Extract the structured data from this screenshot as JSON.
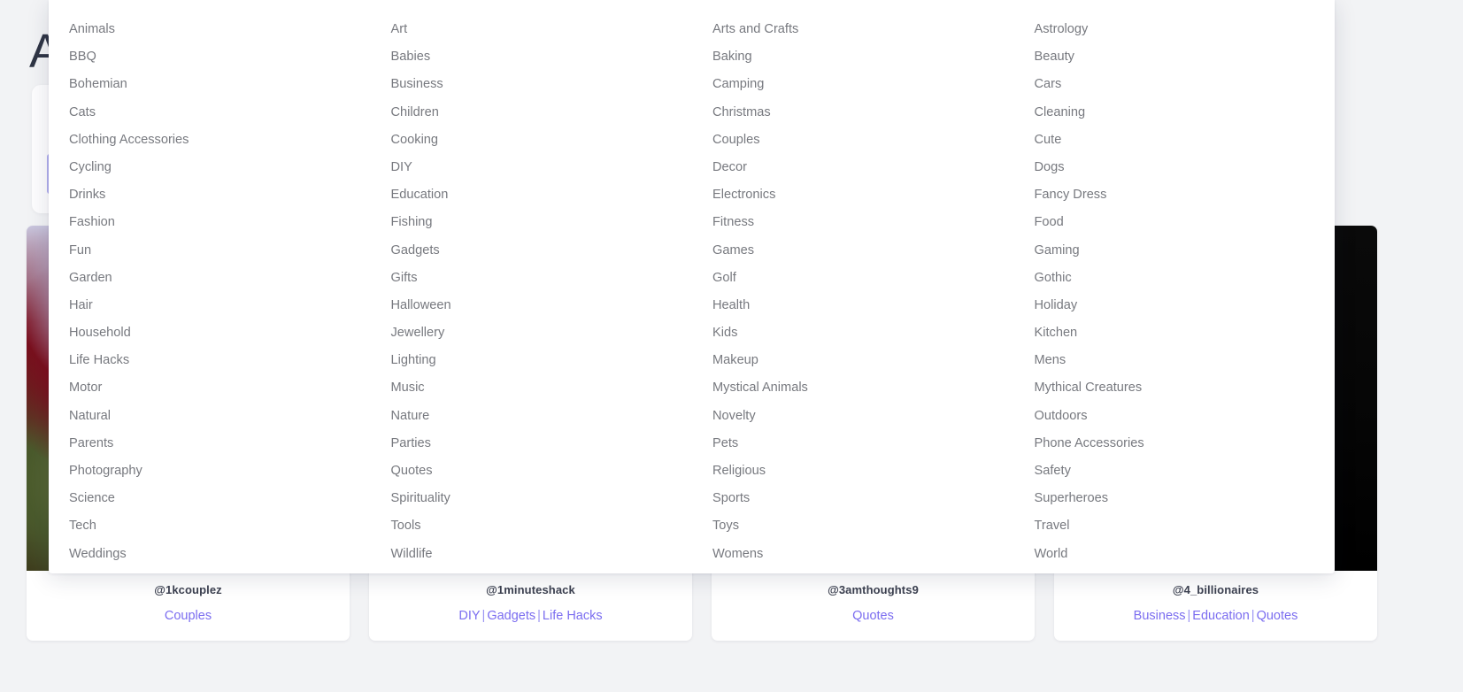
{
  "page": {
    "title": "A",
    "background_color": "#f2f3f5"
  },
  "theme": {
    "link_color": "#7b6df0",
    "menu_text_color": "#77797f",
    "handle_color": "#3c4150",
    "accent_color": "#b3b2f0"
  },
  "dropdown": {
    "name": "category-dropdown",
    "columns": [
      {
        "items": [
          "Animals",
          "BBQ",
          "Bohemian",
          "Cats",
          "Clothing Accessories",
          "Cycling",
          "Drinks",
          "Fashion",
          "Fun",
          "Garden",
          "Hair",
          "Household",
          "Life Hacks",
          "Motor",
          "Natural",
          "Parents",
          "Photography",
          "Science",
          "Tech",
          "Weddings"
        ]
      },
      {
        "items": [
          "Art",
          "Babies",
          "Business",
          "Children",
          "Cooking",
          "DIY",
          "Education",
          "Fishing",
          "Gadgets",
          "Gifts",
          "Halloween",
          "Jewellery",
          "Lighting",
          "Music",
          "Nature",
          "Parties",
          "Quotes",
          "Spirituality",
          "Tools",
          "Wildlife"
        ]
      },
      {
        "items": [
          "Arts and Crafts",
          "Baking",
          "Camping",
          "Christmas",
          "Couples",
          "Decor",
          "Electronics",
          "Fitness",
          "Games",
          "Golf",
          "Health",
          "Kids",
          "Makeup",
          "Mystical Animals",
          "Novelty",
          "Pets",
          "Religious",
          "Sports",
          "Toys",
          "Womens"
        ]
      },
      {
        "items": [
          "Astrology",
          "Beauty",
          "Cars",
          "Cleaning",
          "Cute",
          "Dogs",
          "Fancy Dress",
          "Food",
          "Gaming",
          "Gothic",
          "Holiday",
          "Kitchen",
          "Mens",
          "Mythical Creatures",
          "Outdoors",
          "Phone Accessories",
          "Safety",
          "Superheroes",
          "Travel",
          "World"
        ]
      }
    ]
  },
  "cards": [
    {
      "handle": "@1kcouplez",
      "tags": [
        "Couples"
      ],
      "thumb": "roses-photo"
    },
    {
      "handle": "@1minuteshack",
      "tags": [
        "DIY",
        "Gadgets",
        "Life Hacks"
      ],
      "thumb": "plain"
    },
    {
      "handle": "@3amthoughts9",
      "tags": [
        "Quotes"
      ],
      "thumb": "plain"
    },
    {
      "handle": "@4_billionaires",
      "tags": [
        "Business",
        "Education",
        "Quotes"
      ],
      "thumb": "dark-photo"
    }
  ]
}
